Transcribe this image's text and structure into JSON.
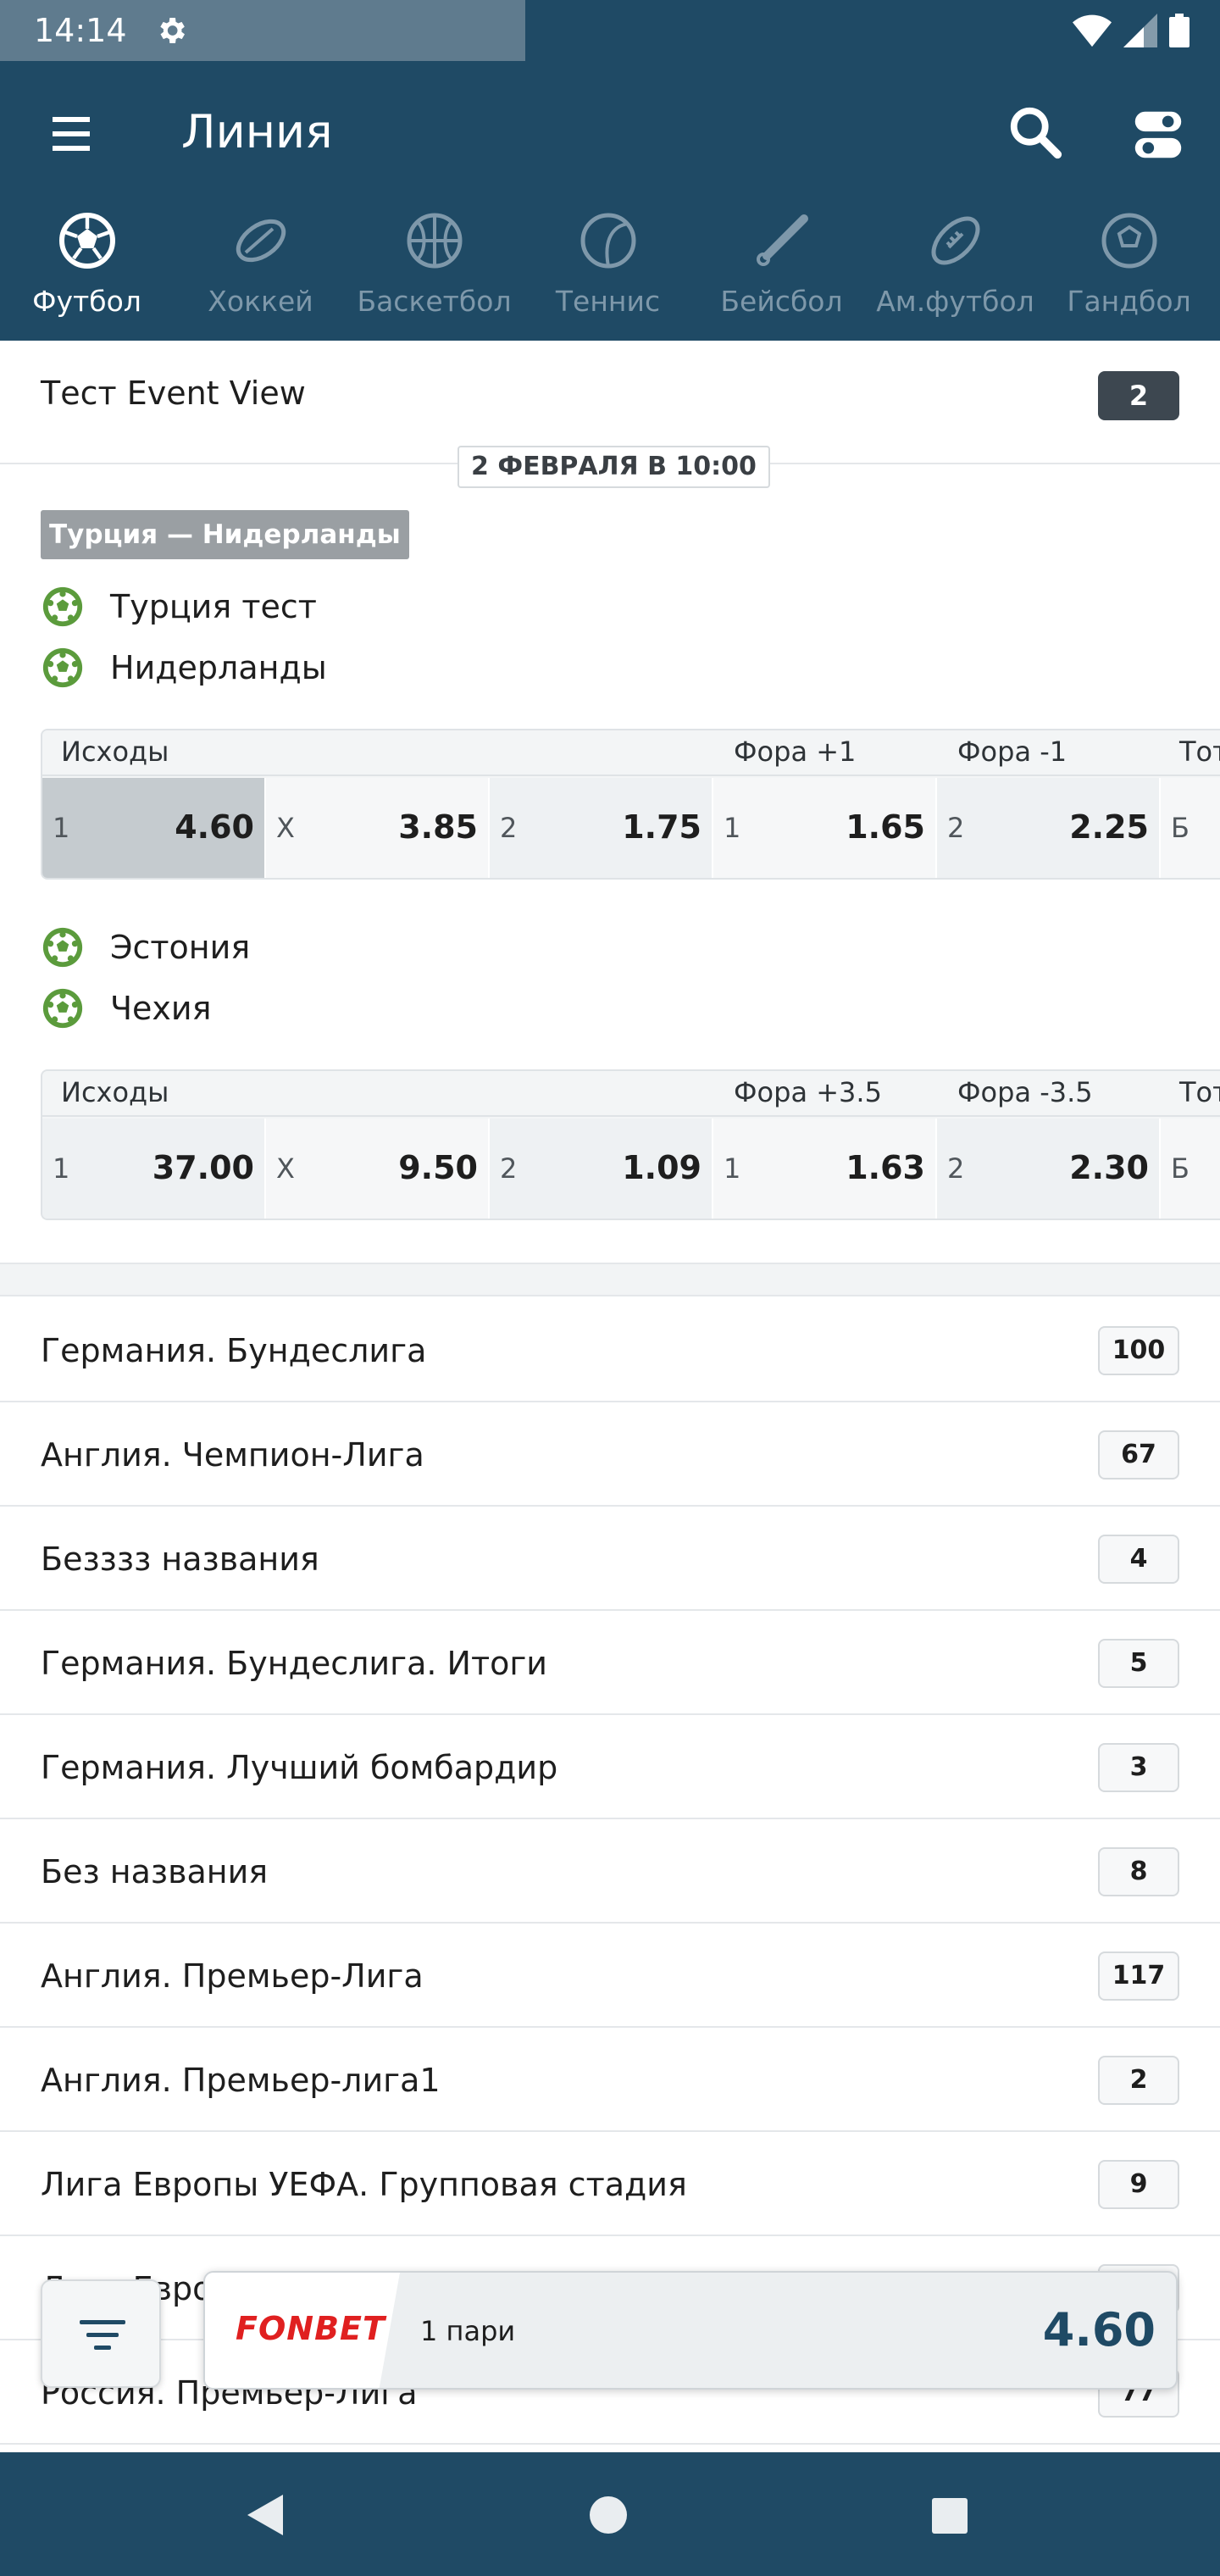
{
  "status_bar": {
    "time": "14:14"
  },
  "header": {
    "title": "Линия"
  },
  "sports": [
    {
      "label": "Футбол",
      "icon": "soccer-ball-icon",
      "active": true
    },
    {
      "label": "Хоккей",
      "icon": "hockey-puck-icon",
      "active": false
    },
    {
      "label": "Баскетбол",
      "icon": "basketball-icon",
      "active": false
    },
    {
      "label": "Теннис",
      "icon": "tennis-ball-icon",
      "active": false
    },
    {
      "label": "Бейсбол",
      "icon": "baseball-bat-icon",
      "active": false
    },
    {
      "label": "Ам.футбол",
      "icon": "american-football-icon",
      "active": false
    },
    {
      "label": "Гандбол",
      "icon": "handball-icon",
      "active": false
    }
  ],
  "featured": {
    "name": "Тест Event View",
    "count": "2",
    "date": "2 ФЕВРАЛЯ В 10:00",
    "event_tag": "Турция — Нидерланды",
    "events": [
      {
        "home": "Турция тест",
        "away": "Нидерланды",
        "headers": {
          "outcomes": "Исходы",
          "h1": "Фора +1",
          "h2": "Фора -1",
          "total": "Тот"
        },
        "cells": [
          {
            "k": "1",
            "v": "4.60"
          },
          {
            "k": "X",
            "v": "3.85"
          },
          {
            "k": "2",
            "v": "1.75"
          },
          {
            "k": "1",
            "v": "1.65"
          },
          {
            "k": "2",
            "v": "2.25"
          },
          {
            "k": "Б",
            "v": ""
          }
        ]
      },
      {
        "home": "Эстония",
        "away": "Чехия",
        "headers": {
          "outcomes": "Исходы",
          "h1": "Фора +3.5",
          "h2": "Фора -3.5",
          "total": "Тот"
        },
        "cells": [
          {
            "k": "1",
            "v": "37.00"
          },
          {
            "k": "X",
            "v": "9.50"
          },
          {
            "k": "2",
            "v": "1.09"
          },
          {
            "k": "1",
            "v": "1.63"
          },
          {
            "k": "2",
            "v": "2.30"
          },
          {
            "k": "Б",
            "v": ""
          }
        ]
      }
    ]
  },
  "leagues": [
    {
      "name": "Германия. Бундеслига",
      "count": "100"
    },
    {
      "name": "Англия. Чемпион-Лига",
      "count": "67"
    },
    {
      "name": "Безззз названия",
      "count": "4"
    },
    {
      "name": "Германия. Бундеслига. Итоги",
      "count": "5"
    },
    {
      "name": "Германия. Лучший бомбардир",
      "count": "3"
    },
    {
      "name": "Без названия",
      "count": "8"
    },
    {
      "name": "Англия. Премьер-Лига",
      "count": "117"
    },
    {
      "name": "Англия. Премьер-лига1",
      "count": "2"
    },
    {
      "name": "Лига Европы УЕФА. Групповая стадия",
      "count": "9"
    },
    {
      "name": "Лига Европы",
      "count": ""
    },
    {
      "name": "Россия. Премьер-Лига",
      "count": "77"
    }
  ],
  "betslip": {
    "brand": "FONBET",
    "count_label": "1 пари",
    "odds": "4.60"
  },
  "colors": {
    "header_bg": "#1f4a65",
    "brand_red": "#e02020",
    "selected_cell": "#c5cbcf"
  }
}
